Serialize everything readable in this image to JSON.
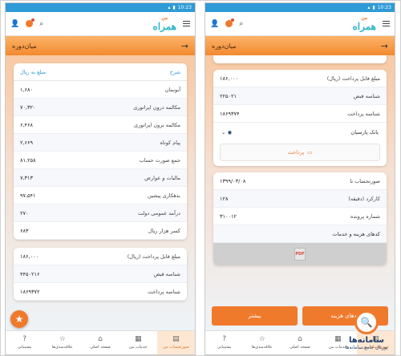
{
  "status": {
    "time": "10:23"
  },
  "app": {
    "logo_text": "همراه",
    "logo_sub": "من"
  },
  "left": {
    "title": "میان‌دوره",
    "table_header": {
      "label": "شرح",
      "value": "مبلغ به ریال"
    },
    "rows": [
      {
        "label": "آبونمان",
        "value": "۱,۶۸۰"
      },
      {
        "label": "مکالمه درون اپراتوری",
        "value": "۷۰,۳۲۰"
      },
      {
        "label": "مکالمه برون اپراتوری",
        "value": "۶,۴۶۸"
      },
      {
        "label": "پیام کوتاه",
        "value": "۲,۶۶۹"
      },
      {
        "label": "جمع صورت حساب",
        "value": "۸۱,۲۵۸"
      },
      {
        "label": "مالیات و عوارض",
        "value": "۷,۳۱۳"
      },
      {
        "label": "بدهکاری پیشین",
        "value": "۹۷,۵۴۱"
      },
      {
        "label": "درآمد عمومی دولت",
        "value": "۲۷۰"
      },
      {
        "label": "کسر هزار ریال",
        "value": "۶۸۳"
      }
    ],
    "card2_rows": [
      {
        "label": "مبلغ قابل پرداخت (ریال)",
        "value": "۱۸۶,۰۰۰"
      },
      {
        "label": "شناسه قبض",
        "value": "۴۴۵۰۲۱۶"
      },
      {
        "label": "شناسه پرداخت",
        "value": "۱۸۶۹۳۷۲"
      }
    ],
    "nav": [
      {
        "icon": "?",
        "label": "پشتیبانی"
      },
      {
        "icon": "☆",
        "label": "علاقه‌مندی‌ها"
      },
      {
        "icon": "⌂",
        "label": "صفحه اصلی"
      },
      {
        "icon": "▦",
        "label": "خدمات من"
      },
      {
        "icon": "▤",
        "label": "صورتحساب من"
      }
    ]
  },
  "right": {
    "title": "میان‌دوره",
    "card1_rows": [
      {
        "label": "مبلغ قابل پرداخت (ریال)",
        "value": "۱۸۶,۰۰۰"
      },
      {
        "label": "شناسه قبض",
        "value": "۲۲۵۰۲۱"
      },
      {
        "label": "شناسه پرداخت",
        "value": "۱۸۶۹۳۷۴"
      }
    ],
    "bank_label": "بانک پارسیان",
    "pay_label": "پرداخت",
    "card2_rows": [
      {
        "label": "صورتحساب تا",
        "value": "۱۳۹۹/۰۳/۰۸"
      },
      {
        "label": "کارکرد (دقیقه)",
        "value": "۱۲۸"
      },
      {
        "label": "شماره پرونده",
        "value": "۳۱۰۰۱۲"
      }
    ],
    "services_label": "کدهای هزینه و خدمات",
    "pdf_label": "PDF",
    "buttons": {
      "cost_codes": "کدهای هزینه",
      "more": "بیشتر"
    },
    "nav": [
      {
        "icon": "?",
        "label": "پشتیبانی"
      },
      {
        "icon": "☆",
        "label": "علاقه‌مندی‌ها"
      },
      {
        "icon": "⌂",
        "label": "صفحه اصلی"
      },
      {
        "icon": "▦",
        "label": "خدمات من"
      },
      {
        "icon": "▤",
        "label": "صورتحساب من"
      }
    ]
  },
  "watermark": {
    "title": "سامانه‌ها",
    "subtitle": "پورتال جامع سامانه‌ها"
  },
  "colors": {
    "accent": "#f07a2c",
    "primary": "#2f9bd6",
    "brand": "#2eb6c9"
  }
}
